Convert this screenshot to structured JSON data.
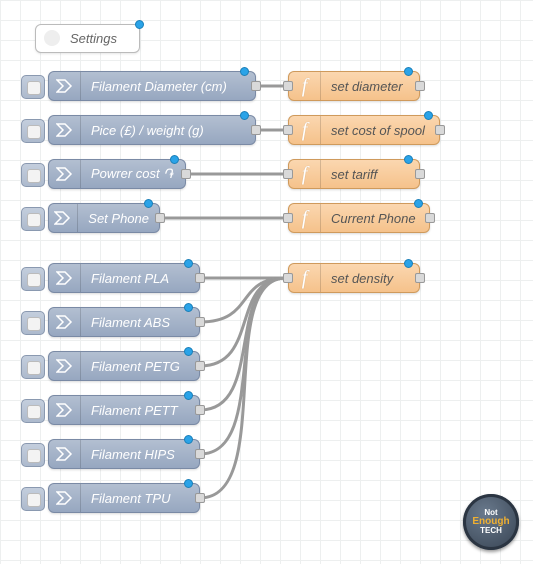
{
  "comment": {
    "label": "Settings"
  },
  "inputs": [
    {
      "label": "Filament Diameter (cm)"
    },
    {
      "label": "Pice (£) / weight (g)"
    },
    {
      "label": "Powrer cost ֏"
    },
    {
      "label": "Set Phone"
    },
    {
      "label": "Filament PLA"
    },
    {
      "label": "Filament ABS"
    },
    {
      "label": "Filament PETG"
    },
    {
      "label": "Filament PETT"
    },
    {
      "label": "Filament HIPS"
    },
    {
      "label": "Filament TPU"
    }
  ],
  "functions": [
    {
      "label": "set diameter"
    },
    {
      "label": "set cost of spool"
    },
    {
      "label": "set tariff"
    },
    {
      "label": "Current Phone"
    },
    {
      "label": "set density"
    }
  ],
  "logo": {
    "line1": "Not",
    "line2": "Enough",
    "line3": "TECH"
  }
}
